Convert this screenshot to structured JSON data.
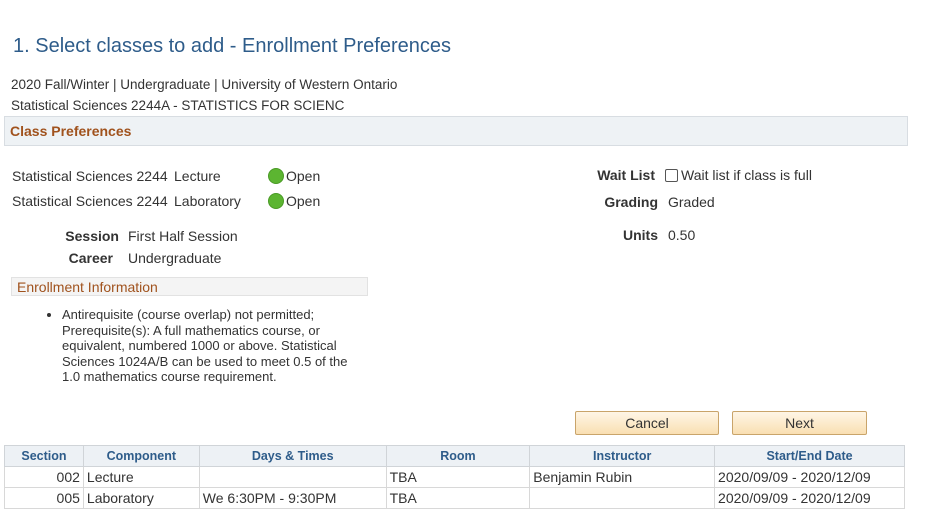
{
  "page": {
    "title": "1.  Select classes to add - Enrollment Preferences",
    "term_line": "2020 Fall/Winter | Undergraduate | University of Western Ontario",
    "course_line": "Statistical Sciences 2244A - STATISTICS FOR SCIENC"
  },
  "section_header": "Class Preferences",
  "classes": [
    {
      "course": "Statistical Sciences 2244",
      "component": "Lecture",
      "status": "Open"
    },
    {
      "course": "Statistical Sciences 2244",
      "component": "Laboratory",
      "status": "Open"
    }
  ],
  "status_color": "#5cb531",
  "details": {
    "session_label": "Session",
    "session_value": "First Half Session",
    "career_label": "Career",
    "career_value": "Undergraduate",
    "waitlist_label": "Wait List",
    "waitlist_checkbox_text": "Wait list if class is full",
    "grading_label": "Grading",
    "grading_value": "Graded",
    "units_label": "Units",
    "units_value": "0.50"
  },
  "enrollment_info": {
    "header": "Enrollment Information",
    "note": "Antirequisite (course overlap) not permitted; Prerequisite(s): A full mathematics course, or equivalent, numbered 1000 or above. Statistical Sciences 1024A/B can be used to meet 0.5 of the 1.0 mathematics course requirement."
  },
  "buttons": {
    "cancel": "Cancel",
    "next": "Next"
  },
  "schedule": {
    "headers": [
      "Section",
      "Component",
      "Days & Times",
      "Room",
      "Instructor",
      "Start/End Date"
    ],
    "rows": [
      {
        "section": "002",
        "component": "Lecture",
        "days_times": "",
        "room": "TBA",
        "instructor": "Benjamin  Rubin",
        "dates": "2020/09/09 - 2020/12/09"
      },
      {
        "section": "005",
        "component": "Laboratory",
        "days_times": "We 6:30PM - 9:30PM",
        "room": "TBA",
        "instructor": "",
        "dates": "2020/09/09 - 2020/12/09"
      }
    ]
  },
  "accent_color": "#2e5c8a",
  "section_color": "#a0521d"
}
